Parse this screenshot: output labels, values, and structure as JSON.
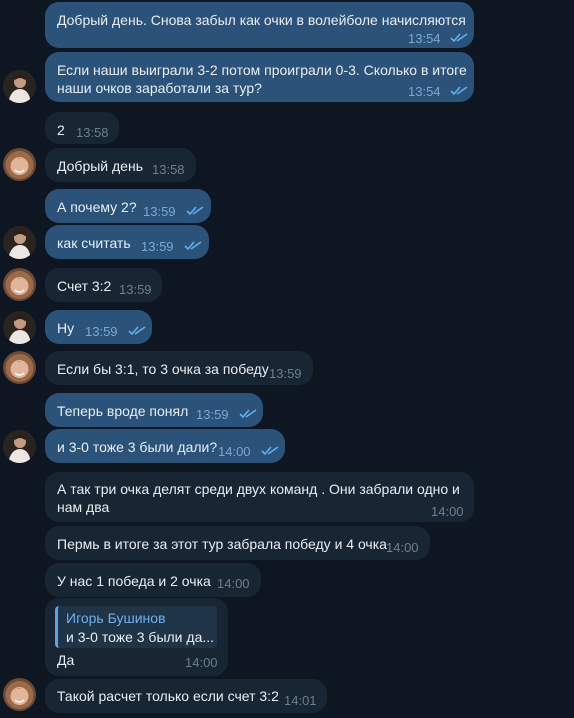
{
  "messages": [
    {
      "text": "Добрый день. Снова забыл как очки в волейболе начисляются",
      "time": "13:54",
      "direction": "out",
      "status": "read"
    },
    {
      "text_lines": [
        "Если наши выиграли 3-2 потом проиграли 0-3. Сколько в итоге",
        "наши очков заработали за тур?"
      ],
      "time": "13:54",
      "direction": "out",
      "status": "read"
    },
    {
      "text": "2",
      "time": "13:58",
      "direction": "in"
    },
    {
      "text": "Добрый день",
      "time": "13:58",
      "direction": "in"
    },
    {
      "text": "А почему 2?",
      "time": "13:59",
      "direction": "out",
      "status": "read"
    },
    {
      "text": "как считать",
      "time": "13:59",
      "direction": "out",
      "status": "read"
    },
    {
      "text": "Счет 3:2",
      "time": "13:59",
      "direction": "in"
    },
    {
      "text": "Ну",
      "time": "13:59",
      "direction": "out",
      "status": "read"
    },
    {
      "text": "Если бы 3:1, то 3 очка за победу",
      "time": "13:59",
      "direction": "in"
    },
    {
      "text": "Теперь вроде понял",
      "time": "13:59",
      "direction": "out",
      "status": "read"
    },
    {
      "text": "и 3-0 тоже 3 были дали?",
      "time": "14:00",
      "direction": "out",
      "status": "read"
    },
    {
      "text_lines": [
        "А так три очка делят среди двух  команд . Они забрали одно и",
        "нам два"
      ],
      "time": "14:00",
      "direction": "in"
    },
    {
      "text": "Пермь в итоге за этот тур забрала победу и 4 очка",
      "time": "14:00",
      "direction": "in"
    },
    {
      "text": "У нас 1 победа и 2 очка",
      "time": "14:00",
      "direction": "in"
    },
    {
      "reply": {
        "author": "Игорь Бушинов",
        "text": "и 3-0 тоже 3 были да..."
      },
      "text": "Да",
      "time": "14:00",
      "direction": "in"
    },
    {
      "text": "Такой расчет только если счет 3:2",
      "time": "14:01",
      "direction": "in"
    }
  ],
  "colors": {
    "background": "#0e1621",
    "outgoing_bubble": "#2b5278",
    "incoming_bubble": "#182533",
    "read_ticks": "#5fb2f2",
    "reply_accent": "#5ea4e0"
  },
  "icons": {
    "read_status": "double-check-icon",
    "avatar_me": "user-avatar-man",
    "avatar_other": "user-avatar-woman"
  }
}
